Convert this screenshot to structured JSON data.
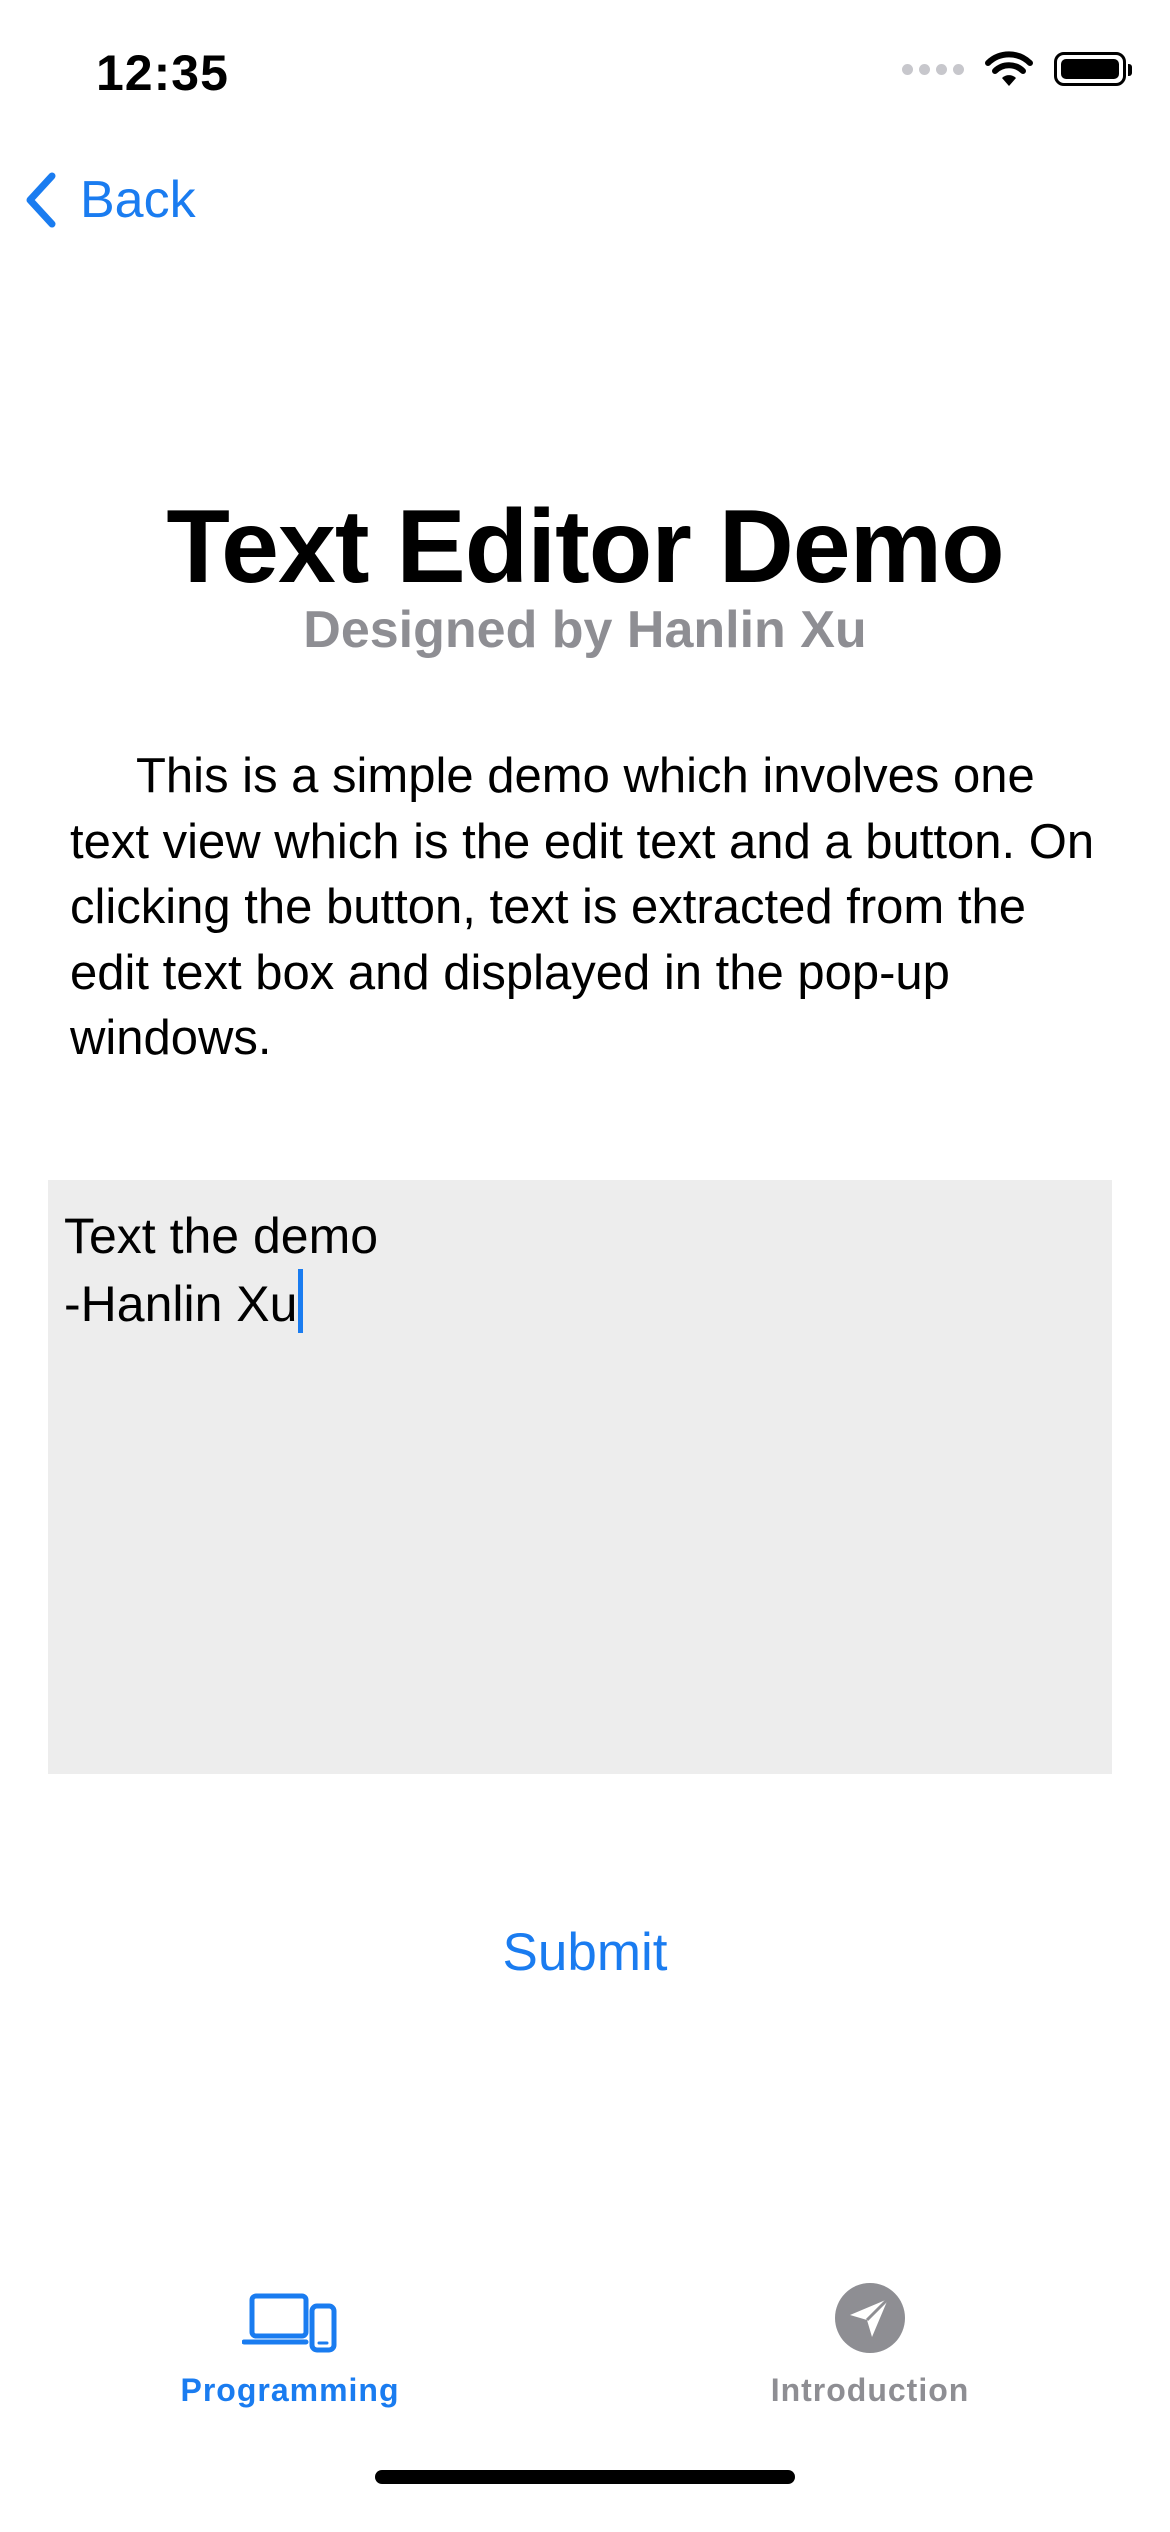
{
  "status_bar": {
    "time": "12:35"
  },
  "nav": {
    "back_label": "Back"
  },
  "header": {
    "title": "Text Editor Demo",
    "subtitle": "Designed by Hanlin Xu"
  },
  "description": "This is a simple demo which involves one text view which is the edit text and a button. On clicking the button, text is extracted from the edit text box and displayed in the pop-up windows.",
  "editor": {
    "lines": [
      "Text the demo",
      "-Hanlin Xu"
    ]
  },
  "submit_label": "Submit",
  "tab_bar": {
    "tabs": [
      {
        "label": "Programming",
        "icon": "laptop-phone-icon",
        "selected": true
      },
      {
        "label": "Introduction",
        "icon": "paperplane-icon",
        "selected": false
      }
    ]
  },
  "colors": {
    "accent": "#1a7cf0",
    "secondary_text": "#8e8e93",
    "editor_background": "#ededed"
  }
}
